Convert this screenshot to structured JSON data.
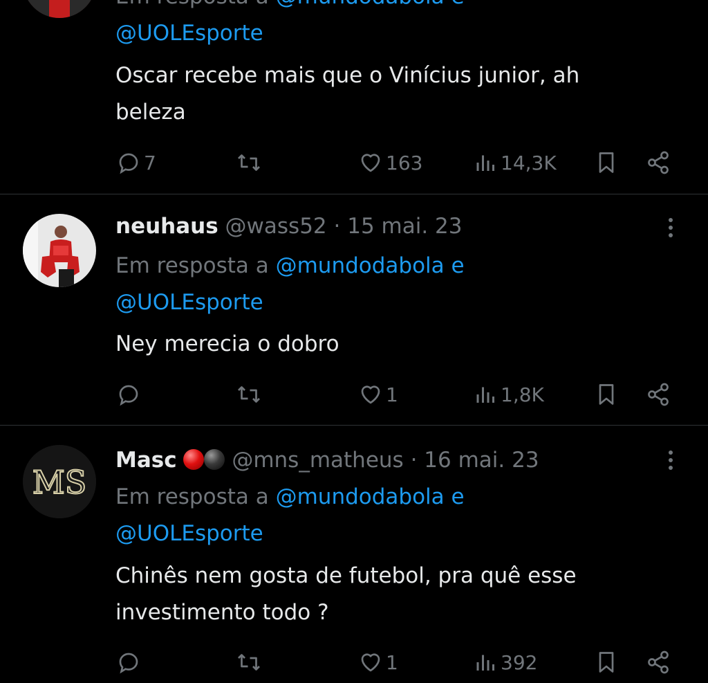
{
  "tweets": [
    {
      "reply_prefix": "Em resposta a",
      "reply_mentions": "@mundodabola e",
      "reply_mention2": "@UOLEsporte",
      "text_line1": "Oscar recebe mais que o Vinícius junior, ah",
      "text_line2": "beleza",
      "replies": "7",
      "likes": "163",
      "views": "14,3K"
    },
    {
      "name": "neuhaus",
      "handle": "@wass52",
      "sep": "·",
      "date": "15 mai. 23",
      "reply_prefix": "Em resposta a",
      "reply_mentions": "@mundodabola e",
      "reply_mention2": "@UOLEsporte",
      "text_line1": "Ney merecia o dobro",
      "replies": "",
      "likes": "1",
      "views": "1,8K"
    },
    {
      "name": "Masc",
      "handle": "@mns_matheus",
      "sep": "·",
      "date": "16 mai. 23",
      "avatar_text": "MS",
      "reply_prefix": "Em resposta a",
      "reply_mentions": "@mundodabola e",
      "reply_mention2": "@UOLEsporte",
      "text_line1": "Chinês nem gosta de futebol, pra quê esse",
      "text_line2": "investimento todo ?",
      "replies": "",
      "likes": "1",
      "views": "392"
    }
  ],
  "icons": {
    "reply": "reply-icon",
    "retweet": "retweet-icon",
    "like": "heart-icon",
    "views": "views-icon",
    "bookmark": "bookmark-icon",
    "share": "share-icon",
    "more": "more-icon"
  },
  "colors": {
    "background": "#000000",
    "text": "#e7e9ea",
    "muted": "#71767b",
    "link": "#1d9bf0",
    "divider": "#2f3336"
  }
}
